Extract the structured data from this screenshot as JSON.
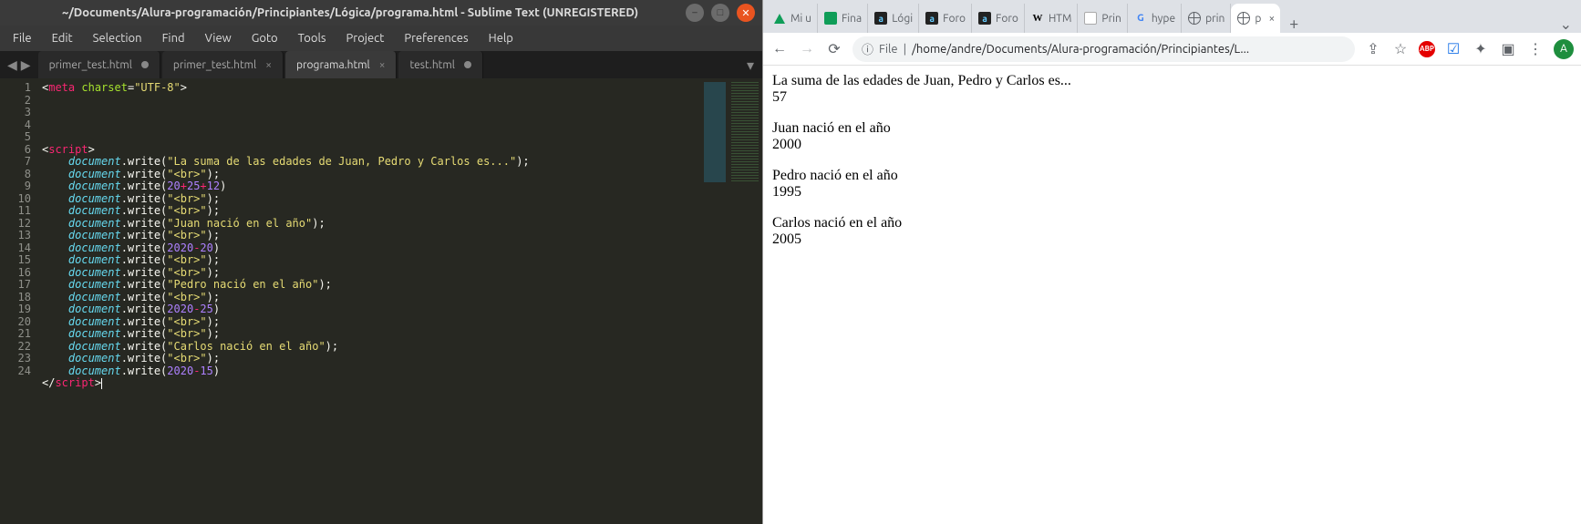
{
  "sublime": {
    "title": "~/Documents/Alura-programación/Principiantes/Lógica/programa.html - Sublime Text (UNREGISTERED)",
    "menus": [
      "File",
      "Edit",
      "Selection",
      "Find",
      "View",
      "Goto",
      "Tools",
      "Project",
      "Preferences",
      "Help"
    ],
    "tabs": [
      {
        "label": "primer_test.html",
        "dirty": true,
        "active": false
      },
      {
        "label": "primer_test.html",
        "dirty": false,
        "active": false,
        "closeable": true
      },
      {
        "label": "programa.html",
        "dirty": false,
        "active": true,
        "closeable": true
      },
      {
        "label": "test.html",
        "dirty": true,
        "active": false
      }
    ],
    "line_numbers": [
      "1",
      "2",
      "3",
      "4",
      "5",
      "6",
      "7",
      "8",
      "9",
      "10",
      "11",
      "12",
      "13",
      "14",
      "15",
      "16",
      "17",
      "18",
      "19",
      "20",
      "21",
      "22",
      "23",
      "24"
    ],
    "code": {
      "l1_tag": "meta",
      "l1_attr": "charset",
      "l1_val": "\"UTF-8\"",
      "script_open": "script",
      "script_close": "script",
      "obj": "document",
      "fn": ".write(",
      "s_sum": "\"La suma de las edades de Juan, Pedro y Carlos es...\"",
      "s_br": "\"<br>\"",
      "n20": "20",
      "n25": "25",
      "n12": "12",
      "s_juan": "\"Juan nació en el año\"",
      "n2020": "2020",
      "s_pedro": "\"Pedro nació en el año\"",
      "s_carlos": "\"Carlos nació en el año\"",
      "n15": "15"
    }
  },
  "browser": {
    "tabs": [
      {
        "icon": "drive",
        "label": "Mi u"
      },
      {
        "icon": "sheets",
        "label": "Fina"
      },
      {
        "icon": "alura",
        "label": "Lógi"
      },
      {
        "icon": "alura",
        "label": "Foro"
      },
      {
        "icon": "alura",
        "label": "Foro"
      },
      {
        "icon": "wiki",
        "label": "HTM"
      },
      {
        "icon": "doc",
        "label": "Prin"
      },
      {
        "icon": "google",
        "label": "hype"
      },
      {
        "icon": "globe",
        "label": "prin"
      },
      {
        "icon": "globe",
        "label": "p",
        "active": true,
        "closeable": true
      }
    ],
    "address": {
      "scheme_label": "File",
      "path": "/home/andre/Documents/Alura-programación/Principiantes/L..."
    },
    "avatar_letter": "A",
    "page": {
      "l1": "La suma de las edades de Juan, Pedro y Carlos es...",
      "l2": "57",
      "l3": "Juan nació en el año",
      "l4": "2000",
      "l5": "Pedro nació en el año",
      "l6": "1995",
      "l7": "Carlos nació en el año",
      "l8": "2005"
    }
  }
}
